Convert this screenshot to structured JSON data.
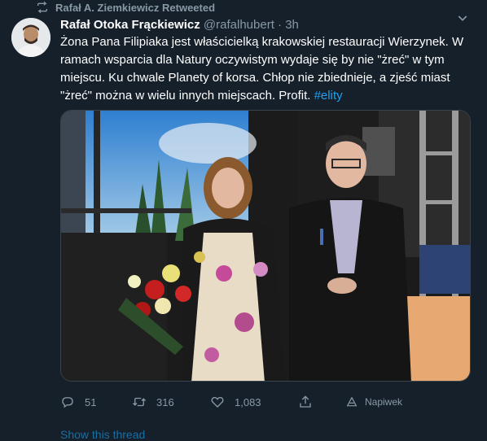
{
  "retweet_context": {
    "text": "Rafał A. Ziemkiewicz Retweeted",
    "icon": "retweet-icon"
  },
  "tweet": {
    "author_name": "Rafał Otoka Frąckiewicz",
    "handle": "@rafalhubert",
    "separator": "·",
    "time": "3h",
    "text": "Żona Pana Filipiaka jest właścicielką krakowskiej restauracji Wierzynek. W ramach wsparcia dla Natury oczywistym wydaje się by nie \"żreć\" w tym miejscu. Ku chwale Planety of korsa. Chłop nie zbiednieje, a zjeść miast \"żreć\" można w wielu innych miejscach. Profit.",
    "hashtag": "#elity",
    "more_icon": "chevron-down-icon"
  },
  "actions": {
    "reply_count": "51",
    "retweet_count": "316",
    "like_count": "1,083",
    "tip_label": "Napiwek"
  },
  "footer": {
    "show_thread": "Show this thread"
  },
  "colors": {
    "background": "#15202b",
    "text": "#ffffff",
    "muted": "#8899a6",
    "accent": "#1da1f2"
  }
}
